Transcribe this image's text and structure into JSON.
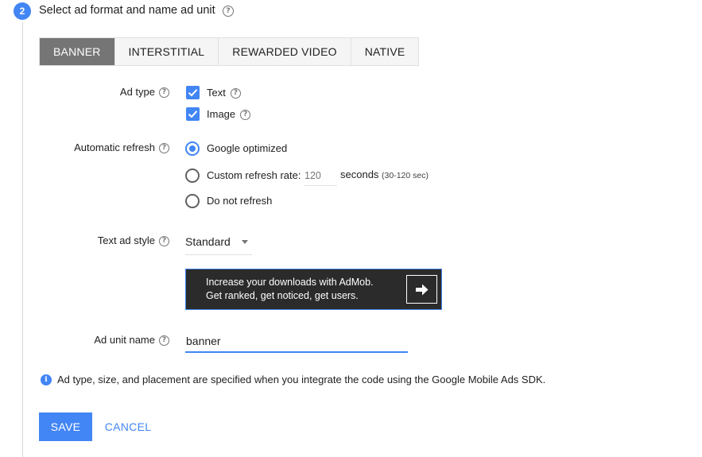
{
  "step": {
    "number": "2",
    "title": "Select ad format and name ad unit",
    "help": "?"
  },
  "tabs": [
    {
      "label": "BANNER",
      "active": true
    },
    {
      "label": "INTERSTITIAL",
      "active": false
    },
    {
      "label": "REWARDED VIDEO",
      "active": false
    },
    {
      "label": "NATIVE",
      "active": false
    }
  ],
  "ad_type": {
    "label": "Ad type",
    "options": [
      {
        "label": "Text",
        "checked": true
      },
      {
        "label": "Image",
        "checked": true
      }
    ]
  },
  "automatic_refresh": {
    "label": "Automatic refresh",
    "options": [
      {
        "label": "Google optimized",
        "selected": true
      },
      {
        "label": "Custom refresh rate:",
        "selected": false
      },
      {
        "label": "Do not refresh",
        "selected": false
      }
    ],
    "rate_placeholder": "120",
    "seconds_label": "seconds",
    "seconds_range": "(30-120 sec)"
  },
  "text_ad_style": {
    "label": "Text ad style",
    "selected": "Standard"
  },
  "preview": {
    "line1": "Increase your downloads with AdMob.",
    "line2": "Get ranked, get noticed, get users."
  },
  "ad_unit_name": {
    "label": "Ad unit name",
    "value": "banner"
  },
  "info": {
    "icon": "i",
    "text": "Ad type, size, and placement are specified when you integrate the code using the Google Mobile Ads SDK."
  },
  "actions": {
    "save": "SAVE",
    "cancel": "CANCEL"
  },
  "colors": {
    "accent": "#4285f4",
    "active_tab": "#757575",
    "preview_bg": "#2b2b2b"
  }
}
